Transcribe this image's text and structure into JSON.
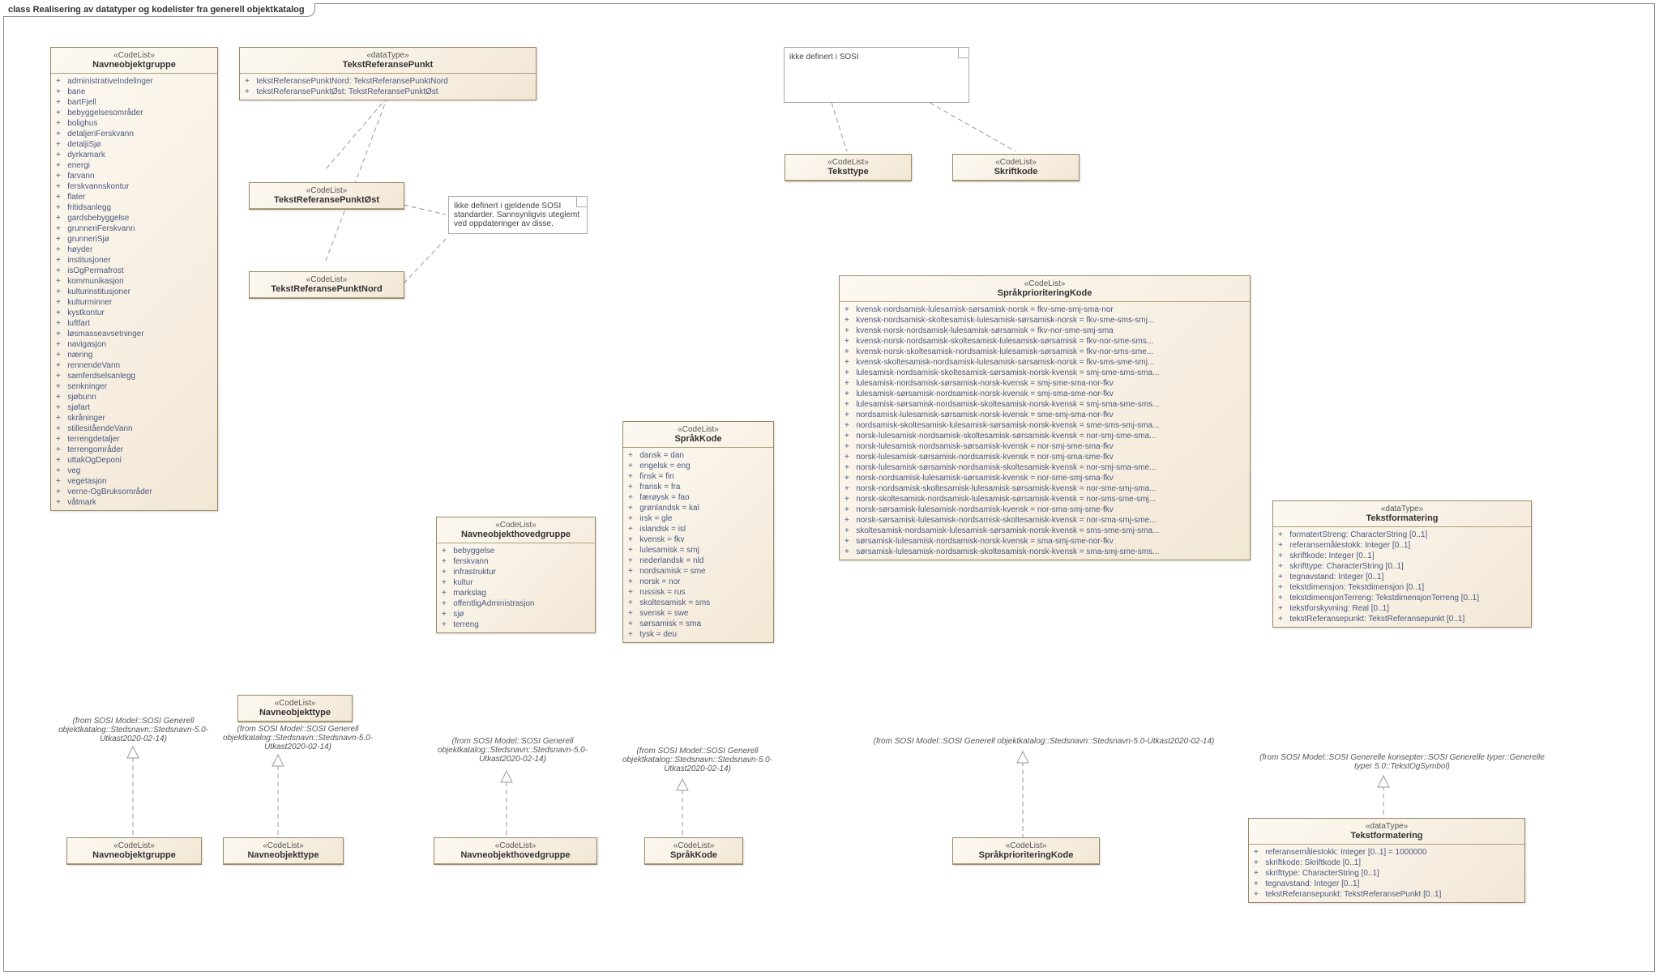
{
  "diagram": {
    "title": "class Realisering av datatyper og kodelister fra generell objektkatalog"
  },
  "notes": {
    "sosistd": "Ikke definert i gjeldende SOSI standarder. Sannsynligvis uteglemt ved oppdateringer av disse.",
    "ikkedef": "ikke definert i SOSI"
  },
  "captions": {
    "stedsnavn1": "(from SOSI Model::SOSI Generell objektkatalog::Stedsnavn::Stedsnavn-5.0-Utkast2020-02-14)",
    "stedsnavn2": "(from SOSI Model::SOSI Generell objektkatalog::Stedsnavn::Stedsnavn-5.0-Utkast2020-02-14)",
    "stedsnavn3": "(from SOSI Model::SOSI Generell objektkatalog::Stedsnavn::Stedsnavn-5.0-Utkast2020-02-14)",
    "generelle": "(from SOSI Model::SOSI Generelle konsepter::SOSI Generelle typer::Generelle typer 5.0::TekstOgSymbol)"
  },
  "boxes": {
    "nog": {
      "stereo": "«CodeList»",
      "name": "Navneobjektgruppe",
      "attrs": [
        "administrativeIndelinger",
        "bane",
        "bartFjell",
        "bebyggelsesområder",
        "bolighus",
        "detaljeriFerskvann",
        "detaljiSjø",
        "dyrkamark",
        "energi",
        "farvann",
        "ferskvannskontur",
        "flater",
        "fritidsanlegg",
        "gardsbebyggelse",
        "grunneriFerskvann",
        "grunneriSjø",
        "høyder",
        "institusjoner",
        "isOgPermafrost",
        "kommunikasjon",
        "kulturinstitusjoner",
        "kulturminner",
        "kystkontur",
        "luftfart",
        "løsmasseavsetninger",
        "navigasjon",
        "næring",
        "rennendeVann",
        "samferdselsanlegg",
        "senkninger",
        "sjøbunn",
        "sjøfart",
        "skråninger",
        "stillesitåendeVann",
        "terrengdetaljer",
        "terrengområder",
        "uttakOgDeponi",
        "veg",
        "vegetasjon",
        "verne-OgBruksområder",
        "våtmark"
      ]
    },
    "trp": {
      "stereo": "«dataType»",
      "name": "TekstReferansePunkt",
      "attrs": [
        "tekstReferansePunktNord: TekstReferansePunktNord",
        "tekstReferansePunktØst: TekstReferansePunktØst"
      ]
    },
    "trpo": {
      "stereo": "«CodeList»",
      "name": "TekstReferansePunktØst"
    },
    "trpn": {
      "stereo": "«CodeList»",
      "name": "TekstReferansePunktNord"
    },
    "teksttype": {
      "stereo": "«CodeList»",
      "name": "Teksttype"
    },
    "skriftkode": {
      "stereo": "«CodeList»",
      "name": "Skriftkode"
    },
    "spk": {
      "stereo": "«CodeList»",
      "name": "SpråkprioriteringKode",
      "attrs": [
        "kvensk-nordsamisk-lulesamisk-sørsamisk-norsk = fkv-sme-smj-sma-nor",
        "kvensk-nordsamisk-skoltesamisk-lulesamisk-sørsamisk-norsk = fkv-sme-sms-smj...",
        "kvensk-norsk-nordsamisk-lulesamisk-sørsamisk = fkv-nor-sme-smj-sma",
        "kvensk-norsk-nordsamisk-skoltesamisk-lulesamisk-sørsamisk = fkv-nor-sme-sms...",
        "kvensk-norsk-skoltesamisk-nordsamisk-lulesamisk-sørsamisk = fkv-nor-sms-sme...",
        "kvensk-skoltesamisk-nordsamisk-lulesamisk-sørsamisk-norsk = fkv-sms-sme-smj...",
        "lulesamisk-nordsamisk-skoltesamisk-sørsamisk-norsk-kvensk = smj-sme-sms-sma...",
        "lulesamisk-nordsamisk-sørsamisk-norsk-kvensk = smj-sme-sma-nor-fkv",
        "lulesamisk-sørsamisk-nordsamisk-norsk-kvensk = smj-sma-sme-nor-fkv",
        "lulesamisk-sørsamisk-nordsamisk-skoltesamisk-norsk-kvensk = smj-sma-sme-sms...",
        "nordsamisk-lulesamisk-sørsamisk-norsk-kvensk = sme-smj-sma-nor-fkv",
        "nordsamisk-skoltesamisk-lulesamisk-sørsamisk-norsk-kvensk = sme-sms-smj-sma...",
        "norsk-lulesamisk-nordsamisk-skoltesamisk-sørsamisk-kvensk = nor-smj-sme-sma...",
        "norsk-lulesamisk-nordsamisk-sørsamisk-kvensk = nor-smj-sme-sma-fkv",
        "norsk-lulesamisk-sørsamisk-nordsamisk-kvensk = nor-smj-sma-sme-fkv",
        "norsk-lulesamisk-sørsamisk-nordsamisk-skoltesamisk-kvensk = nor-smj-sma-sme...",
        "norsk-nordsamisk-lulesamisk-sørsamisk-kvensk = nor-sme-smj-sma-fkv",
        "norsk-nordsamisk-skoltesamisk-lulesamisk-sørsamisk-kvensk = nor-sme-smj-sma...",
        "norsk-skoltesamisk-nordsamisk-lulesamisk-sørsamisk-kvensk = nor-sms-sme-smj...",
        "norsk-sørsamisk-lulesamisk-nordsamisk-kvensk = nor-sma-smj-sme-fkv",
        "norsk-sørsamisk-lulesamisk-nordsamisk-skoltesamisk-kvensk = nor-sma-smj-sme...",
        "skoltesamisk-nordsamisk-lulesamisk-sørsamisk-norsk-kvensk = sms-sme-smj-sma...",
        "sørsamisk-lulesamisk-nordsamisk-norsk-kvensk = sma-smj-sme-nor-fkv",
        "sørsamisk-lulesamisk-nordsamisk-skoltesamisk-norsk-kvensk = sma-smj-sme-sms..."
      ]
    },
    "sk": {
      "stereo": "«CodeList»",
      "name": "SpråkKode",
      "attrs": [
        "dansk = dan",
        "engelsk = eng",
        "finsk = fin",
        "fransk = fra",
        "færøysk = fao",
        "grønlandsk = kal",
        "irsk = gle",
        "islandsk = isl",
        "kvensk = fkv",
        "lulesamisk = smj",
        "nederlandsk = nld",
        "nordsamisk = sme",
        "norsk = nor",
        "russisk = rus",
        "skoltesamisk = sms",
        "svensk = swe",
        "sørsamisk = sma",
        "tysk = deu"
      ]
    },
    "nohg": {
      "stereo": "«CodeList»",
      "name": "Navneobjekthovedgruppe",
      "attrs": [
        "bebyggelse",
        "ferskvann",
        "infrastruktur",
        "kultur",
        "markslag",
        "offentligAdministrasjon",
        "sjø",
        "terreng"
      ]
    },
    "not": {
      "stereo": "«CodeList»",
      "name": "Navneobjekttype"
    },
    "tf1": {
      "stereo": "«dataType»",
      "name": "Tekstformatering",
      "attrs": [
        "formatertStreng: CharacterString [0..1]",
        "referansemålestokk: Integer [0..1]",
        "skriftkode: Integer [0..1]",
        "skrifttype: CharacterString [0..1]",
        "tegnavstand: Integer [0..1]",
        "tekstdimensjon: Tekstdimensjon [0..1]",
        "tekstdimensjonTerreng: TekstdimensjonTerreng [0..1]",
        "tekstforskyvning: Real [0..1]",
        "tekstReferansepunkt: TekstReferansepunkt [0..1]"
      ]
    },
    "tf2": {
      "stereo": "«dataType»",
      "name": "Tekstformatering",
      "attrs": [
        "referansemålestokk: Integer [0..1] = 1000000",
        "skriftkode: Skriftkode [0..1]",
        "skrifttype: CharacterString [0..1]",
        "tegnavstand: Integer [0..1]",
        "tekstReferansepunkt: TekstReferansePunkt [0..1]"
      ]
    },
    "r1": {
      "stereo": "«CodeList»",
      "name": "Navneobjektgruppe"
    },
    "r2": {
      "stereo": "«CodeList»",
      "name": "Navneobjekttype"
    },
    "r3": {
      "stereo": "«CodeList»",
      "name": "Navneobjekthovedgruppe"
    },
    "r4": {
      "stereo": "«CodeList»",
      "name": "SpråkKode"
    },
    "r5": {
      "stereo": "«CodeList»",
      "name": "SpråkprioriteringKode"
    }
  }
}
